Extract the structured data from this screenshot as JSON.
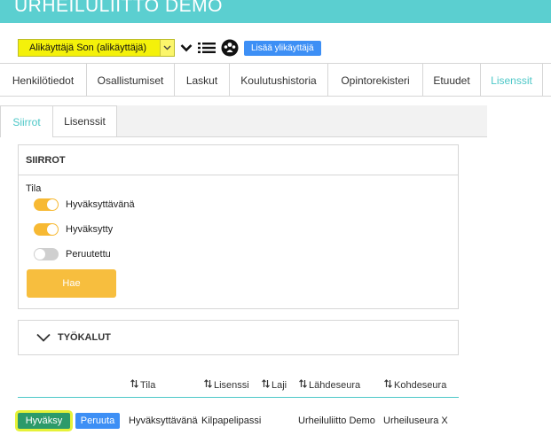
{
  "app": {
    "title": "URHEILULIITTO DEMO"
  },
  "subuser": {
    "selected": "Alikäyttäjä Son (alikäyttäjä)",
    "add_button": "Lisää ylikäyttäjä"
  },
  "main_tabs": [
    {
      "label": "Henkilötiedot",
      "active": false
    },
    {
      "label": "Osallistumiset",
      "active": false
    },
    {
      "label": "Laskut",
      "active": false
    },
    {
      "label": "Koulutushistoria",
      "active": false
    },
    {
      "label": "Opintorekisteri",
      "active": false
    },
    {
      "label": "Etuudet",
      "active": false
    },
    {
      "label": "Lisenssit",
      "active": true
    }
  ],
  "sub_tabs": [
    {
      "label": "Siirrot",
      "active": true
    },
    {
      "label": "Lisenssit",
      "active": false
    }
  ],
  "siirrot": {
    "title": "SIIRROT",
    "filter_label": "Tila",
    "toggles": [
      {
        "label": "Hyväksyttävänä",
        "on": true
      },
      {
        "label": "Hyväksytty",
        "on": true
      },
      {
        "label": "Peruutettu",
        "on": false
      }
    ],
    "search_button": "Hae"
  },
  "tools": {
    "title": "TYÖKALUT"
  },
  "table": {
    "columns": [
      "Tila",
      "Lisenssi",
      "Laji",
      "Lähdeseura",
      "Kohdeseura"
    ],
    "rows": [
      {
        "approve": "Hyväksy",
        "cancel": "Peruuta",
        "tila": "Hyväksyttävänä",
        "lisenssi": "Kilpapelipassi",
        "laji": "",
        "lahdeseura": "Urheiluliitto Demo",
        "kohdeseura": "Urheiluseura X"
      }
    ]
  },
  "colors": {
    "header": "#5bcfd0",
    "accent": "#4cc7c7",
    "toggle_on": "#f7b933",
    "primary_button": "#3d8ff5",
    "approve_button": "#2c9a6a",
    "highlight": "#f4f10a"
  }
}
